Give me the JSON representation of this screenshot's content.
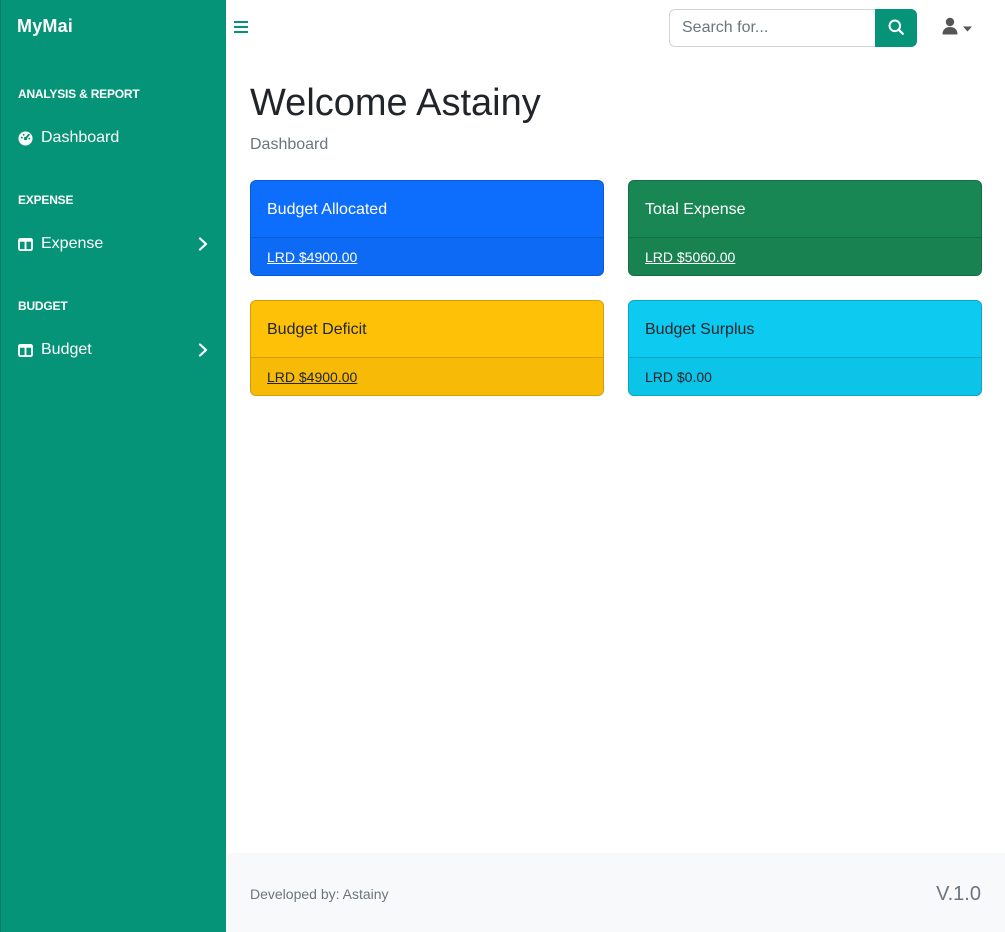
{
  "sidebar": {
    "brand": "MyMai",
    "sections": [
      {
        "heading": "ANALYSIS & REPORT",
        "item": "Dashboard"
      },
      {
        "heading": "EXPENSE",
        "item": "Expense"
      },
      {
        "heading": "BUDGET",
        "item": "Budget"
      }
    ]
  },
  "topbar": {
    "search_placeholder": "Search for..."
  },
  "main": {
    "welcome": "Welcome Astainy",
    "breadcrumb": "Dashboard",
    "cards": [
      {
        "title": "Budget Allocated",
        "value": "LRD $4900.00",
        "color": "#0d6efd"
      },
      {
        "title": "Total Expense",
        "value": "LRD $5060.00",
        "color": "#198754"
      },
      {
        "title": "Budget Deficit",
        "value": "LRD $4900.00",
        "color": "#ffc107"
      },
      {
        "title": "Budget Surplus",
        "value": "LRD $0.00",
        "color": "#0dcaf0"
      }
    ]
  },
  "footer": {
    "developed_by": "Developed by: Astainy",
    "version": "V.1.0"
  },
  "colors": {
    "accent": "#059477"
  }
}
